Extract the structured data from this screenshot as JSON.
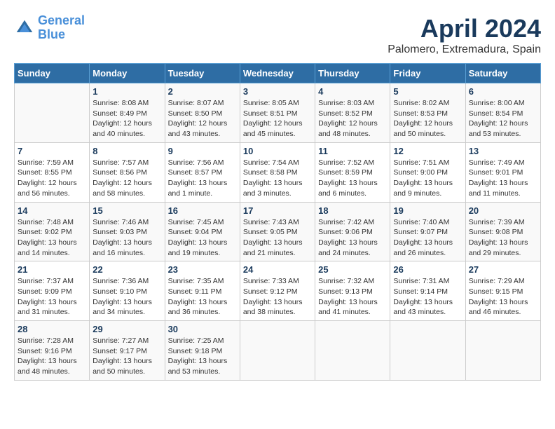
{
  "header": {
    "logo_line1": "General",
    "logo_line2": "Blue",
    "month": "April 2024",
    "location": "Palomero, Extremadura, Spain"
  },
  "days_of_week": [
    "Sunday",
    "Monday",
    "Tuesday",
    "Wednesday",
    "Thursday",
    "Friday",
    "Saturday"
  ],
  "weeks": [
    [
      {
        "num": "",
        "info": ""
      },
      {
        "num": "1",
        "info": "Sunrise: 8:08 AM\nSunset: 8:49 PM\nDaylight: 12 hours\nand 40 minutes."
      },
      {
        "num": "2",
        "info": "Sunrise: 8:07 AM\nSunset: 8:50 PM\nDaylight: 12 hours\nand 43 minutes."
      },
      {
        "num": "3",
        "info": "Sunrise: 8:05 AM\nSunset: 8:51 PM\nDaylight: 12 hours\nand 45 minutes."
      },
      {
        "num": "4",
        "info": "Sunrise: 8:03 AM\nSunset: 8:52 PM\nDaylight: 12 hours\nand 48 minutes."
      },
      {
        "num": "5",
        "info": "Sunrise: 8:02 AM\nSunset: 8:53 PM\nDaylight: 12 hours\nand 50 minutes."
      },
      {
        "num": "6",
        "info": "Sunrise: 8:00 AM\nSunset: 8:54 PM\nDaylight: 12 hours\nand 53 minutes."
      }
    ],
    [
      {
        "num": "7",
        "info": "Sunrise: 7:59 AM\nSunset: 8:55 PM\nDaylight: 12 hours\nand 56 minutes."
      },
      {
        "num": "8",
        "info": "Sunrise: 7:57 AM\nSunset: 8:56 PM\nDaylight: 12 hours\nand 58 minutes."
      },
      {
        "num": "9",
        "info": "Sunrise: 7:56 AM\nSunset: 8:57 PM\nDaylight: 13 hours\nand 1 minute."
      },
      {
        "num": "10",
        "info": "Sunrise: 7:54 AM\nSunset: 8:58 PM\nDaylight: 13 hours\nand 3 minutes."
      },
      {
        "num": "11",
        "info": "Sunrise: 7:52 AM\nSunset: 8:59 PM\nDaylight: 13 hours\nand 6 minutes."
      },
      {
        "num": "12",
        "info": "Sunrise: 7:51 AM\nSunset: 9:00 PM\nDaylight: 13 hours\nand 9 minutes."
      },
      {
        "num": "13",
        "info": "Sunrise: 7:49 AM\nSunset: 9:01 PM\nDaylight: 13 hours\nand 11 minutes."
      }
    ],
    [
      {
        "num": "14",
        "info": "Sunrise: 7:48 AM\nSunset: 9:02 PM\nDaylight: 13 hours\nand 14 minutes."
      },
      {
        "num": "15",
        "info": "Sunrise: 7:46 AM\nSunset: 9:03 PM\nDaylight: 13 hours\nand 16 minutes."
      },
      {
        "num": "16",
        "info": "Sunrise: 7:45 AM\nSunset: 9:04 PM\nDaylight: 13 hours\nand 19 minutes."
      },
      {
        "num": "17",
        "info": "Sunrise: 7:43 AM\nSunset: 9:05 PM\nDaylight: 13 hours\nand 21 minutes."
      },
      {
        "num": "18",
        "info": "Sunrise: 7:42 AM\nSunset: 9:06 PM\nDaylight: 13 hours\nand 24 minutes."
      },
      {
        "num": "19",
        "info": "Sunrise: 7:40 AM\nSunset: 9:07 PM\nDaylight: 13 hours\nand 26 minutes."
      },
      {
        "num": "20",
        "info": "Sunrise: 7:39 AM\nSunset: 9:08 PM\nDaylight: 13 hours\nand 29 minutes."
      }
    ],
    [
      {
        "num": "21",
        "info": "Sunrise: 7:37 AM\nSunset: 9:09 PM\nDaylight: 13 hours\nand 31 minutes."
      },
      {
        "num": "22",
        "info": "Sunrise: 7:36 AM\nSunset: 9:10 PM\nDaylight: 13 hours\nand 34 minutes."
      },
      {
        "num": "23",
        "info": "Sunrise: 7:35 AM\nSunset: 9:11 PM\nDaylight: 13 hours\nand 36 minutes."
      },
      {
        "num": "24",
        "info": "Sunrise: 7:33 AM\nSunset: 9:12 PM\nDaylight: 13 hours\nand 38 minutes."
      },
      {
        "num": "25",
        "info": "Sunrise: 7:32 AM\nSunset: 9:13 PM\nDaylight: 13 hours\nand 41 minutes."
      },
      {
        "num": "26",
        "info": "Sunrise: 7:31 AM\nSunset: 9:14 PM\nDaylight: 13 hours\nand 43 minutes."
      },
      {
        "num": "27",
        "info": "Sunrise: 7:29 AM\nSunset: 9:15 PM\nDaylight: 13 hours\nand 46 minutes."
      }
    ],
    [
      {
        "num": "28",
        "info": "Sunrise: 7:28 AM\nSunset: 9:16 PM\nDaylight: 13 hours\nand 48 minutes."
      },
      {
        "num": "29",
        "info": "Sunrise: 7:27 AM\nSunset: 9:17 PM\nDaylight: 13 hours\nand 50 minutes."
      },
      {
        "num": "30",
        "info": "Sunrise: 7:25 AM\nSunset: 9:18 PM\nDaylight: 13 hours\nand 53 minutes."
      },
      {
        "num": "",
        "info": ""
      },
      {
        "num": "",
        "info": ""
      },
      {
        "num": "",
        "info": ""
      },
      {
        "num": "",
        "info": ""
      }
    ]
  ]
}
